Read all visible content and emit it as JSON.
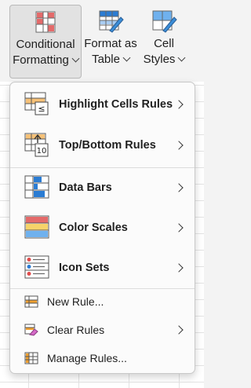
{
  "ribbon": {
    "conditional_formatting": {
      "line1": "Conditional",
      "line2": "Formatting"
    },
    "format_as_table": {
      "line1": "Format as",
      "line2": "Table"
    },
    "cell_styles": {
      "line1": "Cell",
      "line2": "Styles"
    }
  },
  "menu": {
    "highlight_cells_rules": "Highlight Cells Rules",
    "top_bottom_rules": "Top/Bottom Rules",
    "data_bars": "Data Bars",
    "color_scales": "Color Scales",
    "icon_sets": "Icon Sets",
    "new_rule": "New Rule...",
    "clear_rules": "Clear Rules",
    "manage_rules": "Manage Rules..."
  },
  "icons": {
    "highlight_cells_rules": "highlight-cells-icon",
    "top_bottom_rules": "top-bottom-icon",
    "data_bars": "data-bars-icon",
    "color_scales": "color-scales-icon",
    "icon_sets": "icon-sets-icon",
    "new_rule": "new-rule-icon",
    "clear_rules": "clear-rules-icon",
    "manage_rules": "manage-rules-icon"
  },
  "colors": {
    "accent_blue": "#2b7cd3",
    "accent_red": "#e04b4b",
    "accent_orange": "#f0a030"
  }
}
